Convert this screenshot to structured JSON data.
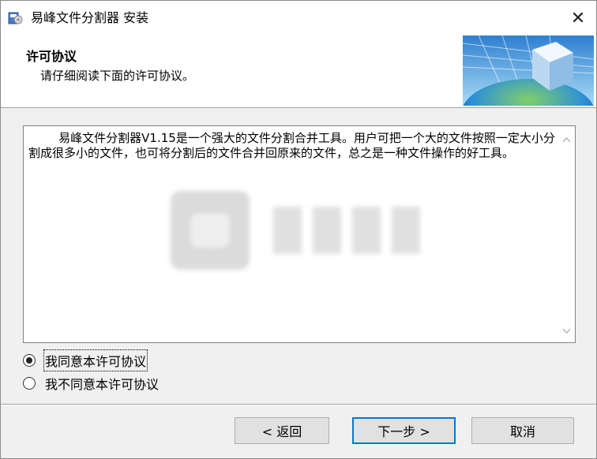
{
  "window": {
    "title": "易峰文件分割器 安装",
    "close_glyph": "✕"
  },
  "header": {
    "title": "许可协议",
    "subtitle": "请仔细阅读下面的许可协议。"
  },
  "license": {
    "text": "        易峰文件分割器V1.15是一个强大的文件分割合并工具。用户可把一个大的文件按照一定大小分割成很多小的文件，也可将分割后的文件合并回原来的文件，总之是一种文件操作的好工具。"
  },
  "radios": [
    {
      "label": "我同意本许可协议",
      "checked": true
    },
    {
      "label": "我不同意本许可协议",
      "checked": false
    }
  ],
  "buttons": {
    "back": "< 返回",
    "next": "下一步 >",
    "cancel": "取消"
  },
  "icons": {
    "app": "installer-disk-icon",
    "logo": "globe-cube-logo",
    "scroll_up": "chevron-up-icon",
    "scroll_down": "chevron-down-icon"
  }
}
